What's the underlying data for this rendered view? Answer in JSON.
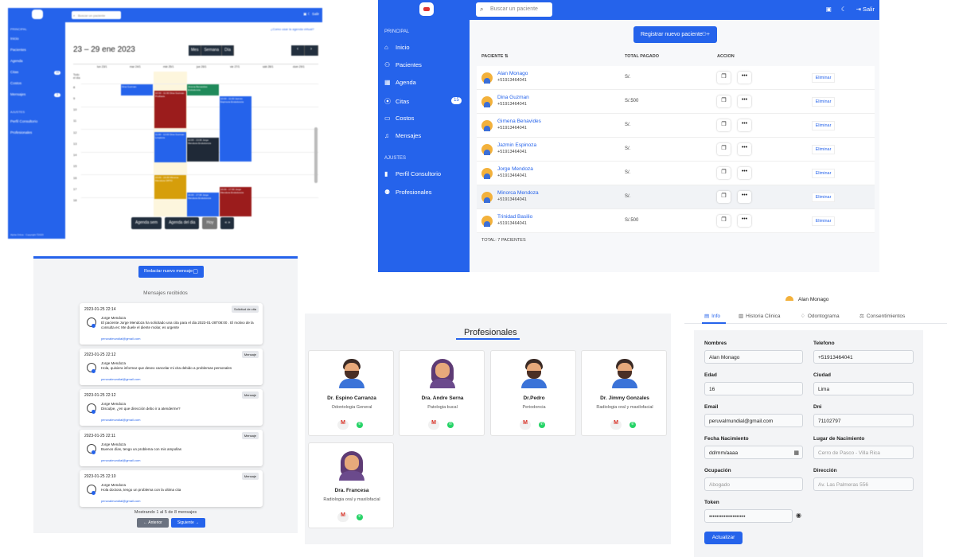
{
  "calendar": {
    "search_placeholder": "Buscar un paciente",
    "logout": "Salir",
    "section_main": "PRINCIPAL",
    "items": [
      "Inicio",
      "Pacientes",
      "Agenda",
      "Citas",
      "Costos",
      "Mensajes"
    ],
    "citas_badge": "15",
    "mensajes_badge": "3",
    "section_settings": "AJUSTES",
    "settings_items": [
      "Perfil Consultorio",
      "Profesionales"
    ],
    "copyright": "Alpha Ortiva · Copyright ©2023",
    "virtual_link": "¿Como usar la agenda virtual?",
    "range": "23 – 29 ene 2023",
    "views": [
      "Mes",
      "Semana",
      "Día"
    ],
    "days": [
      "lun 23/1",
      "mar 24/1",
      "mié 25/1",
      "jue 26/1",
      "vie 27/1",
      "sáb 28/1",
      "dom 29/1"
    ],
    "allday": "Todo el día",
    "hours": [
      "8",
      "9",
      "10",
      "11",
      "12",
      "13",
      "14",
      "15",
      "16",
      "17",
      "18"
    ],
    "events": [
      {
        "text": "Dina Guzman"
      },
      {
        "text": "Jimena Benavides Endodoncia"
      },
      {
        "text": "10:30 - 11:30 Dina Guzman Profilaxis"
      },
      {
        "text": "10:00 - 11:00 Jazmin Espinoza Endodoncia"
      },
      {
        "text": "11:00 - 12:00 Dina Guzman Limpieza"
      },
      {
        "text": "12:00 - 13:00 Jorge Mendoza Endodoncia"
      },
      {
        "text": "15:00 - 16:00 Minorca Mendoza ORTO"
      },
      {
        "text": "16:00 - 17:00 Jorge Mendoza Endodoncia"
      },
      {
        "text": "16:00 - 17:00 Jorge Mendoza Endodoncia"
      }
    ],
    "bottom_buttons": [
      "Agenda sem",
      "Agenda del dia",
      "Hoy",
      "«   »"
    ]
  },
  "patients": {
    "search_placeholder": "Buscar un paciente",
    "logout": "Salir",
    "section_main": "PRINCIPAL",
    "items": [
      "Inicio",
      "Pacientes",
      "Agenda",
      "Citas",
      "Costos",
      "Mensajes"
    ],
    "citas_badge": "15",
    "section_settings": "AJUSTES",
    "settings_items": [
      "Perfil Consultorio",
      "Profesionales"
    ],
    "register_button": "Registrar nuevo paciente",
    "headers": {
      "patient": "PACIENTE",
      "total": "TOTAL PAGADO",
      "action": "ACCION"
    },
    "rows": [
      {
        "name": "Alan Monago",
        "phone": "+51913464041",
        "paid": "S/."
      },
      {
        "name": "Dina Guzman",
        "phone": "+51913464041",
        "paid": "S/.500"
      },
      {
        "name": "Gimena Benavides",
        "phone": "+51913464041",
        "paid": "S/."
      },
      {
        "name": "Jazmin Espinoza",
        "phone": "+51913464041",
        "paid": "S/."
      },
      {
        "name": "Jorge Mendoza",
        "phone": "+51913464041",
        "paid": "S/."
      },
      {
        "name": "Minorca Mendoza",
        "phone": "+51913464041",
        "paid": "S/."
      },
      {
        "name": "Trinidad Basilio",
        "phone": "+51913464041",
        "paid": "S/.500"
      }
    ],
    "delete_label": "Eliminar",
    "total_label": "TOTAL: 7 PACIENTES"
  },
  "messages": {
    "compose_button": "Redactar nuevo mensaje",
    "title": "Mensajes recibidos",
    "items": [
      {
        "date": "2023-01-25 22:14",
        "tag": "Solicitud de cita",
        "from": "Jorge Mendoza",
        "text": "El paciente Jorge Mendoza ha solicitado una cita para el dia 2023-01-28T08:00 . El motivo de la consulta es: Me duele el diente molar, es urgente",
        "email": "peruvalmundial@gmail.com"
      },
      {
        "date": "2023-01-25 22:12",
        "tag": "Mensaje",
        "from": "Jorge Mendoza",
        "text": "Hola, quisiera informar que deseo cancelar mi cita debido a problemas personales",
        "email": "peruvalmundial@gmail.com"
      },
      {
        "date": "2023-01-25 22:12",
        "tag": "Mensaje",
        "from": "Jorge Mendoza",
        "text": "Disculpe, ¿en que dirección debo ir a atenderme?",
        "email": "peruvalmundial@gmail.com"
      },
      {
        "date": "2023-01-25 22:11",
        "tag": "Mensaje",
        "from": "Jorge Mendoza",
        "text": "Buenos días, tengo un problema con mis ampollas",
        "email": "peruvalmundial@gmail.com"
      },
      {
        "date": "2023-01-25 22:10",
        "tag": "Mensaje",
        "from": "Jorge Mendoza",
        "text": "Hola doctora, tengo un problema con la ultima cita",
        "email": "peruvalmundial@gmail.com"
      }
    ],
    "pagination": "Mostrando 1 al 5 de 8 mensajes",
    "prev": "← Anterior",
    "next": "Siguiente →"
  },
  "professionals": {
    "title": "Profesionales",
    "items": [
      {
        "name": "Dr. Espino Carranza",
        "specialty": "Odontologia General",
        "female": false
      },
      {
        "name": "Dra. Andre Serna",
        "specialty": "Patologia bucal",
        "female": true
      },
      {
        "name": "Dr.Pedro",
        "specialty": "Periodoncia",
        "female": false
      },
      {
        "name": "Dr. Jimmy Gonzales",
        "specialty": "Radiologia oral y maxilofacial",
        "female": false
      },
      {
        "name": "Dra. Francesa",
        "specialty": "Radiologia oral y maxilofacial",
        "female": true
      }
    ]
  },
  "patient_form": {
    "patient_name": "Alan Monago",
    "tabs": [
      "Info",
      "Historia Clinica",
      "Odontograma",
      "Consentimientos"
    ],
    "fields": {
      "nombres_label": "Nombres",
      "nombres": "Alan Monago",
      "telefono_label": "Telefono",
      "telefono": "+51913464041",
      "edad_label": "Edad",
      "edad": "16",
      "ciudad_label": "Ciudad",
      "ciudad": "Lima",
      "email_label": "Email",
      "email": "peruvalmundial@gmail.com",
      "dni_label": "Dni",
      "dni": "71102797",
      "fecha_label": "Fecha Nacimiento",
      "fecha": "dd/mm/aaaa",
      "lugar_label": "Lugar de Nacimiento",
      "lugar": "Cerro de Pasco - Villa Rica",
      "ocupacion_label": "Ocupación",
      "ocupacion": "Abogado",
      "direccion_label": "Dirección",
      "direccion": "Av. Las Palmeras 556",
      "token_label": "Token",
      "token": "••••••••••••••••••••"
    },
    "update_button": "Actualizar"
  }
}
